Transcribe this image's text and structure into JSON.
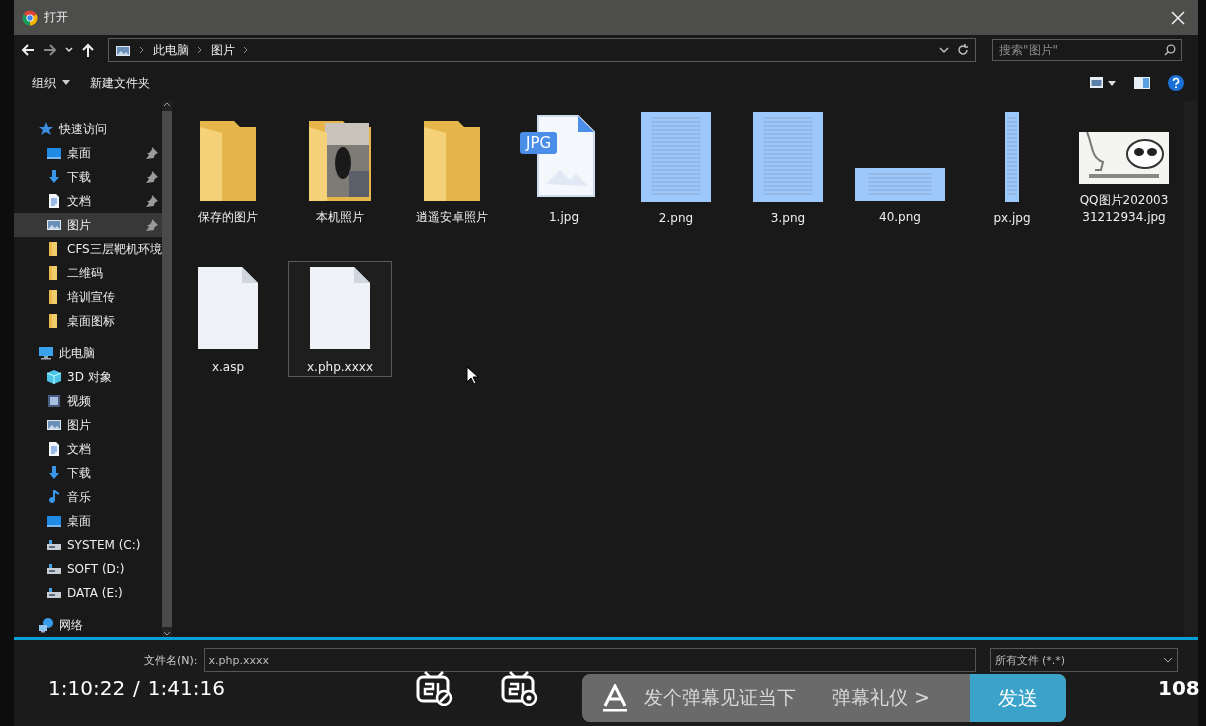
{
  "window": {
    "title": "打开"
  },
  "address": {
    "path": [
      "此电脑",
      "图片"
    ],
    "search_placeholder": "搜索\"图片\""
  },
  "toolbar": {
    "organize": "组织",
    "new_folder": "新建文件夹"
  },
  "sidebar": {
    "items": [
      {
        "label": "快速访问",
        "kind": "star",
        "selected": false,
        "children": [
          {
            "label": "桌面",
            "kind": "desktop",
            "pinned": true,
            "selected": false
          },
          {
            "label": "下载",
            "kind": "download",
            "pinned": true,
            "selected": false
          },
          {
            "label": "文档",
            "kind": "doc",
            "pinned": true,
            "selected": false
          },
          {
            "label": "图片",
            "kind": "picture",
            "pinned": true,
            "selected": true
          },
          {
            "label": "CFS三层靶机环境",
            "kind": "folder",
            "pinned": false,
            "selected": false
          },
          {
            "label": "二维码",
            "kind": "folder",
            "pinned": false,
            "selected": false
          },
          {
            "label": "培训宣传",
            "kind": "folder",
            "pinned": false,
            "selected": false
          },
          {
            "label": "桌面图标",
            "kind": "folder",
            "pinned": false,
            "selected": false
          }
        ]
      },
      {
        "label": "此电脑",
        "kind": "pc",
        "selected": false,
        "children": [
          {
            "label": "3D 对象",
            "kind": "cube",
            "pinned": false,
            "selected": false
          },
          {
            "label": "视频",
            "kind": "video",
            "pinned": false,
            "selected": false
          },
          {
            "label": "图片",
            "kind": "picture",
            "pinned": false,
            "selected": false
          },
          {
            "label": "文档",
            "kind": "doc",
            "pinned": false,
            "selected": false
          },
          {
            "label": "下载",
            "kind": "download",
            "pinned": false,
            "selected": false
          },
          {
            "label": "音乐",
            "kind": "music",
            "pinned": false,
            "selected": false
          },
          {
            "label": "桌面",
            "kind": "desktop",
            "pinned": false,
            "selected": false
          },
          {
            "label": "SYSTEM (C:)",
            "kind": "drive",
            "pinned": false,
            "selected": false
          },
          {
            "label": "SOFT (D:)",
            "kind": "drive",
            "pinned": false,
            "selected": false
          },
          {
            "label": "DATA (E:)",
            "kind": "drive",
            "pinned": false,
            "selected": false
          }
        ]
      },
      {
        "label": "网络",
        "kind": "network",
        "selected": false
      }
    ]
  },
  "files": [
    {
      "name": "保存的图片",
      "kind": "folder",
      "selected": false
    },
    {
      "name": "本机照片",
      "kind": "photo-folder",
      "selected": false
    },
    {
      "name": "逍遥安卓照片",
      "kind": "folder",
      "selected": false
    },
    {
      "name": "1.jpg",
      "kind": "jpg",
      "badge": "JPG",
      "selected": false
    },
    {
      "name": "2.png",
      "kind": "tall-page",
      "selected": false
    },
    {
      "name": "3.png",
      "kind": "tall-page",
      "selected": false
    },
    {
      "name": "40.png",
      "kind": "wide-page",
      "selected": false
    },
    {
      "name": "px.jpg",
      "kind": "strip",
      "selected": false
    },
    {
      "name": "QQ图片20200331212934.jpg",
      "kind": "meme",
      "selected": false
    },
    {
      "name": "x.asp",
      "kind": "blank",
      "selected": false
    },
    {
      "name": "x.php.xxxx",
      "kind": "blank",
      "selected": true
    }
  ],
  "footer": {
    "filename_label": "文件名(N):",
    "filename": "x.php.xxxx",
    "filter": "所有文件 (*.*)"
  },
  "player": {
    "time_current": "1:10:22",
    "separator": "/",
    "time_total": "1:41:16",
    "danmaku_placeholder": "发个弹幕见证当下",
    "etiquette": "弹幕礼仪 >",
    "send": "发送",
    "quality": "108"
  }
}
